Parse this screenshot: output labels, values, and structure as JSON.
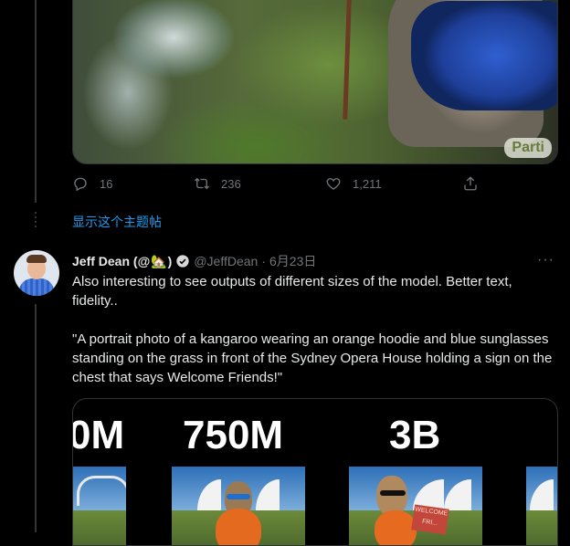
{
  "tweet1": {
    "badge": "Parti",
    "actions": {
      "replies": "16",
      "retweets": "236",
      "likes": "1,211"
    }
  },
  "show_thread": "显示这个主题帖",
  "tweet2": {
    "author_name": "Jeff Dean (@",
    "author_emoji": "🏡",
    "author_close": ")",
    "handle": "@JeffDean",
    "separator": "·",
    "date": "6月23日",
    "more": "···",
    "text_line1": "Also interesting to see outputs of different sizes of the model.  Better text, fidelity..",
    "text_line2": "\"A portrait photo of a kangaroo wearing an orange hoodie and blue sunglasses standing on the grass in front of the Sydney Opera House holding a sign on the chest that says Welcome Friends!\"",
    "media_labels": [
      "0M",
      "750M",
      "3B"
    ],
    "sign_text": "WELCOME FRI..."
  },
  "icons": [
    "reply-icon",
    "retweet-icon",
    "like-icon",
    "share-icon",
    "verified-icon",
    "more-icon"
  ],
  "colors": {
    "background": "#000000",
    "text": "#e7e9ea",
    "muted": "#71767b",
    "link": "#1d9bf0",
    "border": "#2f3336"
  }
}
